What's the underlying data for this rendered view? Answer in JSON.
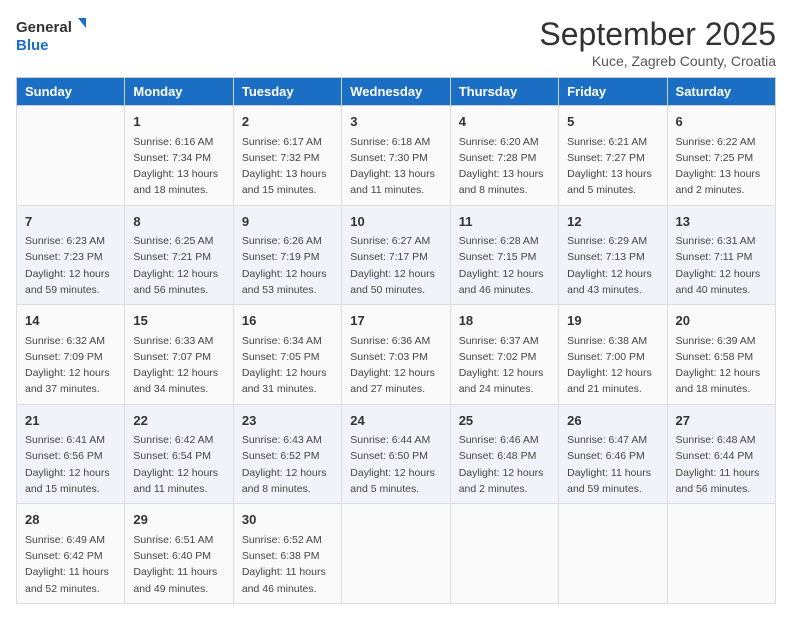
{
  "header": {
    "logo_general": "General",
    "logo_blue": "Blue",
    "month": "September 2025",
    "location": "Kuce, Zagreb County, Croatia"
  },
  "days_of_week": [
    "Sunday",
    "Monday",
    "Tuesday",
    "Wednesday",
    "Thursday",
    "Friday",
    "Saturday"
  ],
  "weeks": [
    [
      {
        "day": "",
        "info": ""
      },
      {
        "day": "1",
        "info": "Sunrise: 6:16 AM\nSunset: 7:34 PM\nDaylight: 13 hours\nand 18 minutes."
      },
      {
        "day": "2",
        "info": "Sunrise: 6:17 AM\nSunset: 7:32 PM\nDaylight: 13 hours\nand 15 minutes."
      },
      {
        "day": "3",
        "info": "Sunrise: 6:18 AM\nSunset: 7:30 PM\nDaylight: 13 hours\nand 11 minutes."
      },
      {
        "day": "4",
        "info": "Sunrise: 6:20 AM\nSunset: 7:28 PM\nDaylight: 13 hours\nand 8 minutes."
      },
      {
        "day": "5",
        "info": "Sunrise: 6:21 AM\nSunset: 7:27 PM\nDaylight: 13 hours\nand 5 minutes."
      },
      {
        "day": "6",
        "info": "Sunrise: 6:22 AM\nSunset: 7:25 PM\nDaylight: 13 hours\nand 2 minutes."
      }
    ],
    [
      {
        "day": "7",
        "info": "Sunrise: 6:23 AM\nSunset: 7:23 PM\nDaylight: 12 hours\nand 59 minutes."
      },
      {
        "day": "8",
        "info": "Sunrise: 6:25 AM\nSunset: 7:21 PM\nDaylight: 12 hours\nand 56 minutes."
      },
      {
        "day": "9",
        "info": "Sunrise: 6:26 AM\nSunset: 7:19 PM\nDaylight: 12 hours\nand 53 minutes."
      },
      {
        "day": "10",
        "info": "Sunrise: 6:27 AM\nSunset: 7:17 PM\nDaylight: 12 hours\nand 50 minutes."
      },
      {
        "day": "11",
        "info": "Sunrise: 6:28 AM\nSunset: 7:15 PM\nDaylight: 12 hours\nand 46 minutes."
      },
      {
        "day": "12",
        "info": "Sunrise: 6:29 AM\nSunset: 7:13 PM\nDaylight: 12 hours\nand 43 minutes."
      },
      {
        "day": "13",
        "info": "Sunrise: 6:31 AM\nSunset: 7:11 PM\nDaylight: 12 hours\nand 40 minutes."
      }
    ],
    [
      {
        "day": "14",
        "info": "Sunrise: 6:32 AM\nSunset: 7:09 PM\nDaylight: 12 hours\nand 37 minutes."
      },
      {
        "day": "15",
        "info": "Sunrise: 6:33 AM\nSunset: 7:07 PM\nDaylight: 12 hours\nand 34 minutes."
      },
      {
        "day": "16",
        "info": "Sunrise: 6:34 AM\nSunset: 7:05 PM\nDaylight: 12 hours\nand 31 minutes."
      },
      {
        "day": "17",
        "info": "Sunrise: 6:36 AM\nSunset: 7:03 PM\nDaylight: 12 hours\nand 27 minutes."
      },
      {
        "day": "18",
        "info": "Sunrise: 6:37 AM\nSunset: 7:02 PM\nDaylight: 12 hours\nand 24 minutes."
      },
      {
        "day": "19",
        "info": "Sunrise: 6:38 AM\nSunset: 7:00 PM\nDaylight: 12 hours\nand 21 minutes."
      },
      {
        "day": "20",
        "info": "Sunrise: 6:39 AM\nSunset: 6:58 PM\nDaylight: 12 hours\nand 18 minutes."
      }
    ],
    [
      {
        "day": "21",
        "info": "Sunrise: 6:41 AM\nSunset: 6:56 PM\nDaylight: 12 hours\nand 15 minutes."
      },
      {
        "day": "22",
        "info": "Sunrise: 6:42 AM\nSunset: 6:54 PM\nDaylight: 12 hours\nand 11 minutes."
      },
      {
        "day": "23",
        "info": "Sunrise: 6:43 AM\nSunset: 6:52 PM\nDaylight: 12 hours\nand 8 minutes."
      },
      {
        "day": "24",
        "info": "Sunrise: 6:44 AM\nSunset: 6:50 PM\nDaylight: 12 hours\nand 5 minutes."
      },
      {
        "day": "25",
        "info": "Sunrise: 6:46 AM\nSunset: 6:48 PM\nDaylight: 12 hours\nand 2 minutes."
      },
      {
        "day": "26",
        "info": "Sunrise: 6:47 AM\nSunset: 6:46 PM\nDaylight: 11 hours\nand 59 minutes."
      },
      {
        "day": "27",
        "info": "Sunrise: 6:48 AM\nSunset: 6:44 PM\nDaylight: 11 hours\nand 56 minutes."
      }
    ],
    [
      {
        "day": "28",
        "info": "Sunrise: 6:49 AM\nSunset: 6:42 PM\nDaylight: 11 hours\nand 52 minutes."
      },
      {
        "day": "29",
        "info": "Sunrise: 6:51 AM\nSunset: 6:40 PM\nDaylight: 11 hours\nand 49 minutes."
      },
      {
        "day": "30",
        "info": "Sunrise: 6:52 AM\nSunset: 6:38 PM\nDaylight: 11 hours\nand 46 minutes."
      },
      {
        "day": "",
        "info": ""
      },
      {
        "day": "",
        "info": ""
      },
      {
        "day": "",
        "info": ""
      },
      {
        "day": "",
        "info": ""
      }
    ]
  ]
}
